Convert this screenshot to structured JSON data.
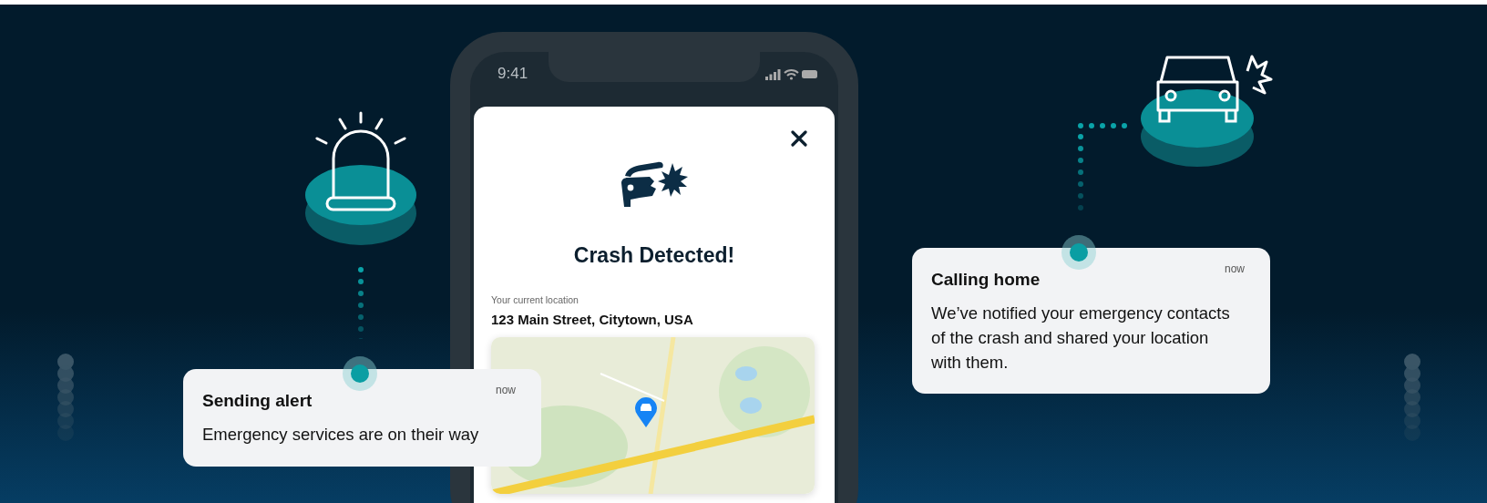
{
  "phone": {
    "status_bar": {
      "time": "9:41"
    },
    "modal": {
      "title": "Crash Detected!",
      "location_label": "Your current location",
      "address": "123 Main Street, Citytown, USA"
    }
  },
  "notifications": [
    {
      "title": "Sending alert",
      "time": "now",
      "body": "Emergency services are on their way"
    },
    {
      "title": "Calling home",
      "time": "now",
      "body": "We’ve notified your emergency contacts of the crash and shared your location with them."
    }
  ]
}
